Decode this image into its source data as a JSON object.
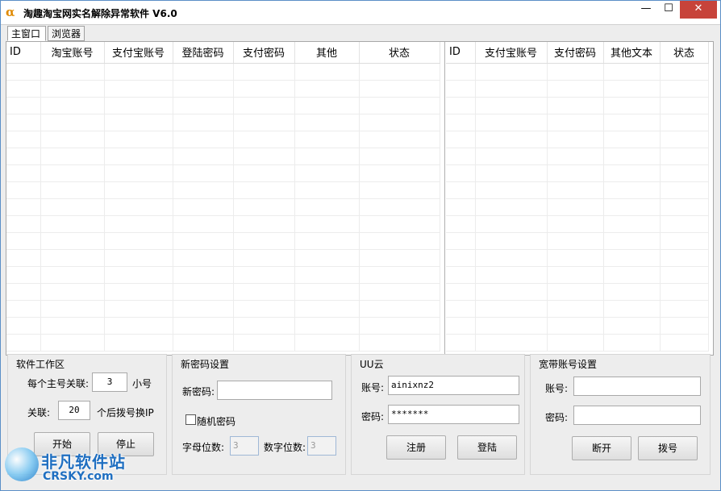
{
  "window": {
    "title": "淘趣淘宝网实名解除异常软件   V6.0",
    "icon": "alpha-icon",
    "min": "—",
    "max": "☐",
    "close": "✕"
  },
  "tabs": [
    {
      "label": "主窗口",
      "active": true
    },
    {
      "label": "浏览器",
      "active": false
    }
  ],
  "left_table": {
    "columns": [
      "ID",
      "淘宝账号",
      "支付宝账号",
      "登陆密码",
      "支付密码",
      "其他",
      "状态"
    ],
    "rows": []
  },
  "right_table": {
    "columns": [
      "ID",
      "支付宝账号",
      "支付密码",
      "其他文本",
      "状态"
    ],
    "rows": []
  },
  "work_area": {
    "title": "软件工作区",
    "per_main_label": "每个主号关联:",
    "per_main_value": "3",
    "per_main_suffix": "小号",
    "link_label": "关联:",
    "link_value": "20",
    "link_suffix": "个后拨号换IP",
    "start_label": "开始",
    "stop_label": "停止"
  },
  "new_password": {
    "title": "新密码设置",
    "password_label": "新密码:",
    "password_value": "",
    "random_label": "随机密码",
    "random_checked": false,
    "letters_label": "字母位数:",
    "letters_value": "3",
    "digits_label": "数字位数:",
    "digits_value": "3"
  },
  "uu_cloud": {
    "title": "UU云",
    "account_label": "账号:",
    "account_value": "ainixnz2",
    "password_label": "密码:",
    "password_value": "*******",
    "register_label": "注册",
    "login_label": "登陆"
  },
  "broadband": {
    "title": "宽带账号设置",
    "account_label": "账号:",
    "account_value": "",
    "password_label": "密码:",
    "password_value": "",
    "disconnect_label": "断开",
    "dial_label": "拨号"
  },
  "watermark": {
    "text": "非凡软件站",
    "sub": "CRSKY.com"
  }
}
